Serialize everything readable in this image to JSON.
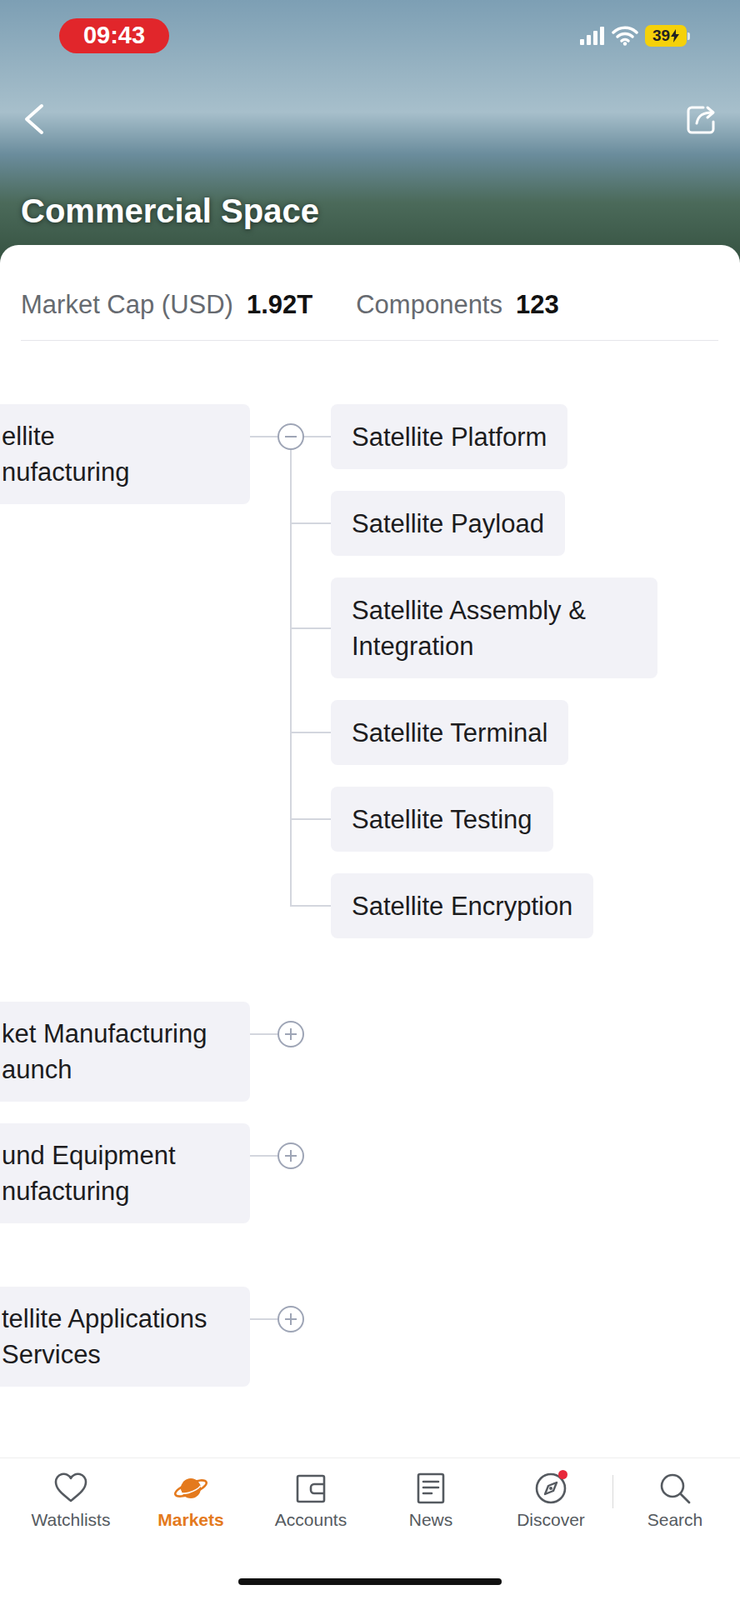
{
  "status_bar": {
    "time": "09:43",
    "battery": "39",
    "charging": true
  },
  "header": {
    "title": "Commercial Space"
  },
  "stats": [
    {
      "label": "Market Cap (USD)",
      "value": "1.92T"
    },
    {
      "label": "Components",
      "value": "123"
    }
  ],
  "tree": {
    "groups": [
      {
        "lines": [
          "ellite",
          "nufacturing"
        ],
        "expanded": true,
        "children": [
          "Satellite Platform",
          "Satellite Payload",
          "Satellite Assembly & Integration",
          "Satellite Terminal",
          "Satellite Testing",
          "Satellite Encryption"
        ]
      },
      {
        "lines": [
          "ket Manufacturing",
          "aunch"
        ],
        "expanded": false,
        "children": []
      },
      {
        "lines": [
          "und Equipment",
          "nufacturing"
        ],
        "expanded": false,
        "children": []
      },
      {
        "lines": [
          "tellite Applications",
          "Services"
        ],
        "expanded": false,
        "children": []
      }
    ]
  },
  "nav": {
    "items": [
      {
        "label": "Watchlists",
        "selected": false,
        "badge": false
      },
      {
        "label": "Markets",
        "selected": true,
        "badge": false
      },
      {
        "label": "Accounts",
        "selected": false,
        "badge": false
      },
      {
        "label": "News",
        "selected": false,
        "badge": false
      },
      {
        "label": "Discover",
        "selected": false,
        "badge": true
      },
      {
        "label": "Search",
        "selected": false,
        "badge": false
      }
    ]
  }
}
